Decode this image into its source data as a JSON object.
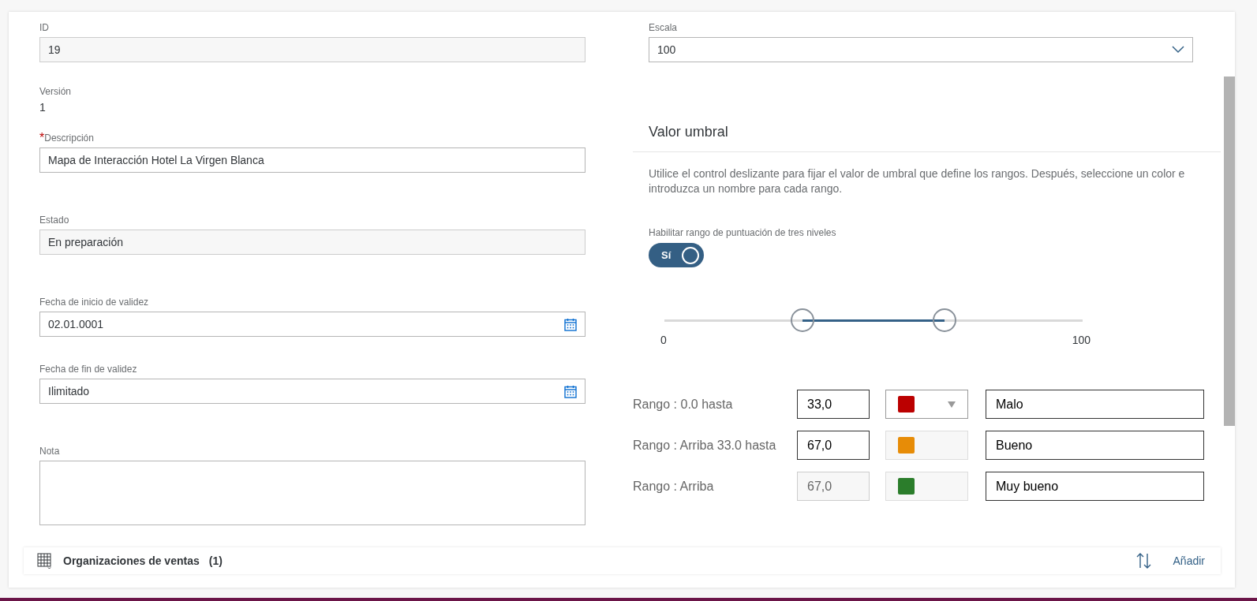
{
  "form": {
    "required_marker": "*",
    "fields": [
      {
        "kind": "readonly",
        "label": "ID",
        "value": "19",
        "required": false
      },
      {
        "kind": "text",
        "label": "Versión",
        "value": "1",
        "required": false
      },
      {
        "kind": "input",
        "label": "Descripción",
        "value": "Mapa de Interacción Hotel La Virgen Blanca",
        "required": true
      },
      {
        "kind": "readonly",
        "label": "Estado",
        "value": "En preparación",
        "required": false
      },
      {
        "kind": "date",
        "label": "Fecha de inicio de validez",
        "value": "02.01.0001",
        "required": false
      },
      {
        "kind": "date",
        "label": "Fecha de fin de validez",
        "value": "Ilimitado",
        "required": false
      },
      {
        "kind": "textarea",
        "label": "Nota",
        "required": false
      }
    ]
  },
  "scale": {
    "label": "Escala",
    "value": "100"
  },
  "threshold": {
    "title": "Valor umbral",
    "description": "Utilice el control deslizante para fijar el valor de umbral que define los rangos. Después, seleccione un color e introduzca un nombre para cada rango.",
    "switch": {
      "label": "Habilitar rango de puntuación de tres niveles",
      "text": "Sí",
      "on": true
    },
    "slider": {
      "min_label": "0",
      "max_label": "100",
      "thumbs": [
        {
          "level": 0.33
        },
        {
          "level": 0.67
        }
      ]
    },
    "ranges": [
      {
        "label": "Rango : 0.0 hasta",
        "value": "33,0",
        "editable": true,
        "color": "#bb0000",
        "dropdown": true,
        "name": "Malo"
      },
      {
        "label": "Rango : Arriba 33.0 hasta",
        "value": "67,0",
        "editable": true,
        "color": "#e78c07",
        "dropdown": false,
        "name": "Bueno"
      },
      {
        "label": "Rango : Arriba",
        "value": "67,0",
        "editable": false,
        "color": "#2b7d2b",
        "dropdown": false,
        "name": "Muy bueno"
      }
    ]
  },
  "sales_orgs": {
    "title": "Organizaciones de ventas",
    "count": "(1)",
    "action": "Añadir"
  }
}
